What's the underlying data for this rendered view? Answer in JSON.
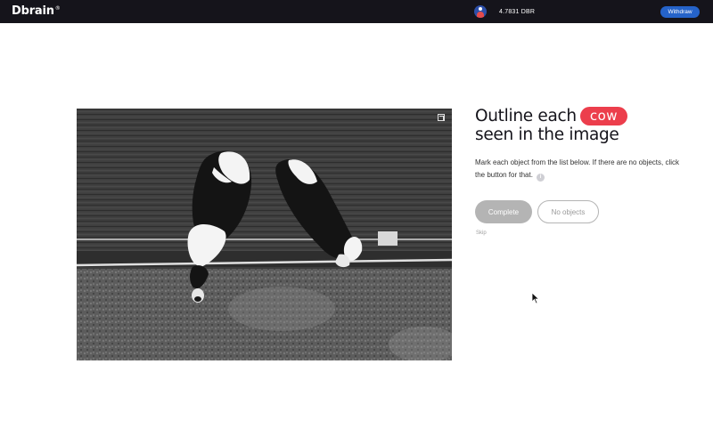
{
  "header": {
    "logo": "Dbrain",
    "logo_mark": "®",
    "balance": "4.7831 DBR",
    "withdraw_label": "Withdraw",
    "avatar_icon": "user-avatar-icon"
  },
  "task": {
    "title_prefix": "Outline each",
    "object": "cow",
    "title_suffix": "seen in the image",
    "description": "Mark each object from the list below. If there are no objects, click the button for that.",
    "info_glyph": "i"
  },
  "actions": {
    "complete_label": "Complete",
    "no_objects_label": "No objects",
    "skip_label": "Skip"
  },
  "colors": {
    "topbar": "#15141b",
    "accent_blue": "#2563c9",
    "chip_red": "#ec3e4c",
    "button_gray": "#b4b4b4"
  }
}
